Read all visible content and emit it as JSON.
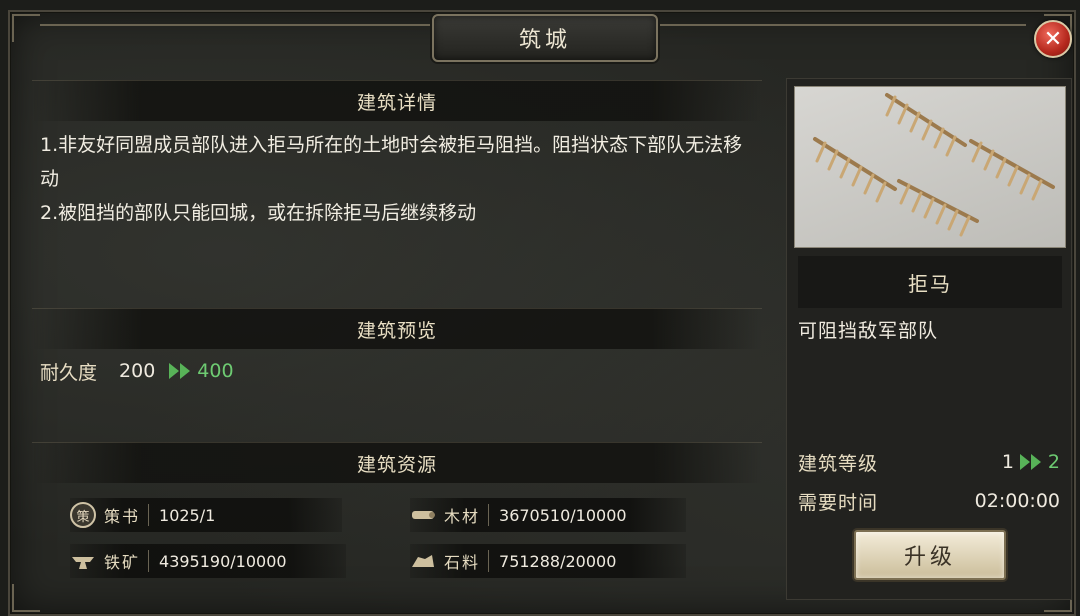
{
  "window": {
    "title": "筑城",
    "close_symbol": "✕"
  },
  "details": {
    "heading": "建筑详情",
    "lines": [
      "1.非友好同盟成员部队进入拒马所在的土地时会被拒马阻挡。阻挡状态下部队无法移动",
      "2.被阻挡的部队只能回城，或在拆除拒马后继续移动"
    ]
  },
  "preview_section": {
    "heading": "建筑预览",
    "durability": {
      "label": "耐久度",
      "from": "200",
      "to": "400"
    }
  },
  "resources_section": {
    "heading": "建筑资源",
    "items": [
      {
        "icon": "book-icon",
        "glyph": "策",
        "name": "策书",
        "value": "1025/1"
      },
      {
        "icon": "wood-icon",
        "name": "木材",
        "value": "3670510/10000"
      },
      {
        "icon": "iron-icon",
        "name": "铁矿",
        "value": "4395190/10000"
      },
      {
        "icon": "stone-icon",
        "name": "石料",
        "value": "751288/20000"
      }
    ]
  },
  "building": {
    "image": "cheval-de-frise-fence-icon",
    "name": "拒马",
    "description": "可阻挡敌军部队",
    "level": {
      "label": "建筑等级",
      "from": "1",
      "to": "2"
    },
    "time": {
      "label": "需要时间",
      "value": "02:00:00"
    },
    "upgrade_label": "升级"
  },
  "colors": {
    "accent_green": "#6ecb72",
    "close_red": "#c0372a",
    "button_cream": "#eee5cf"
  }
}
